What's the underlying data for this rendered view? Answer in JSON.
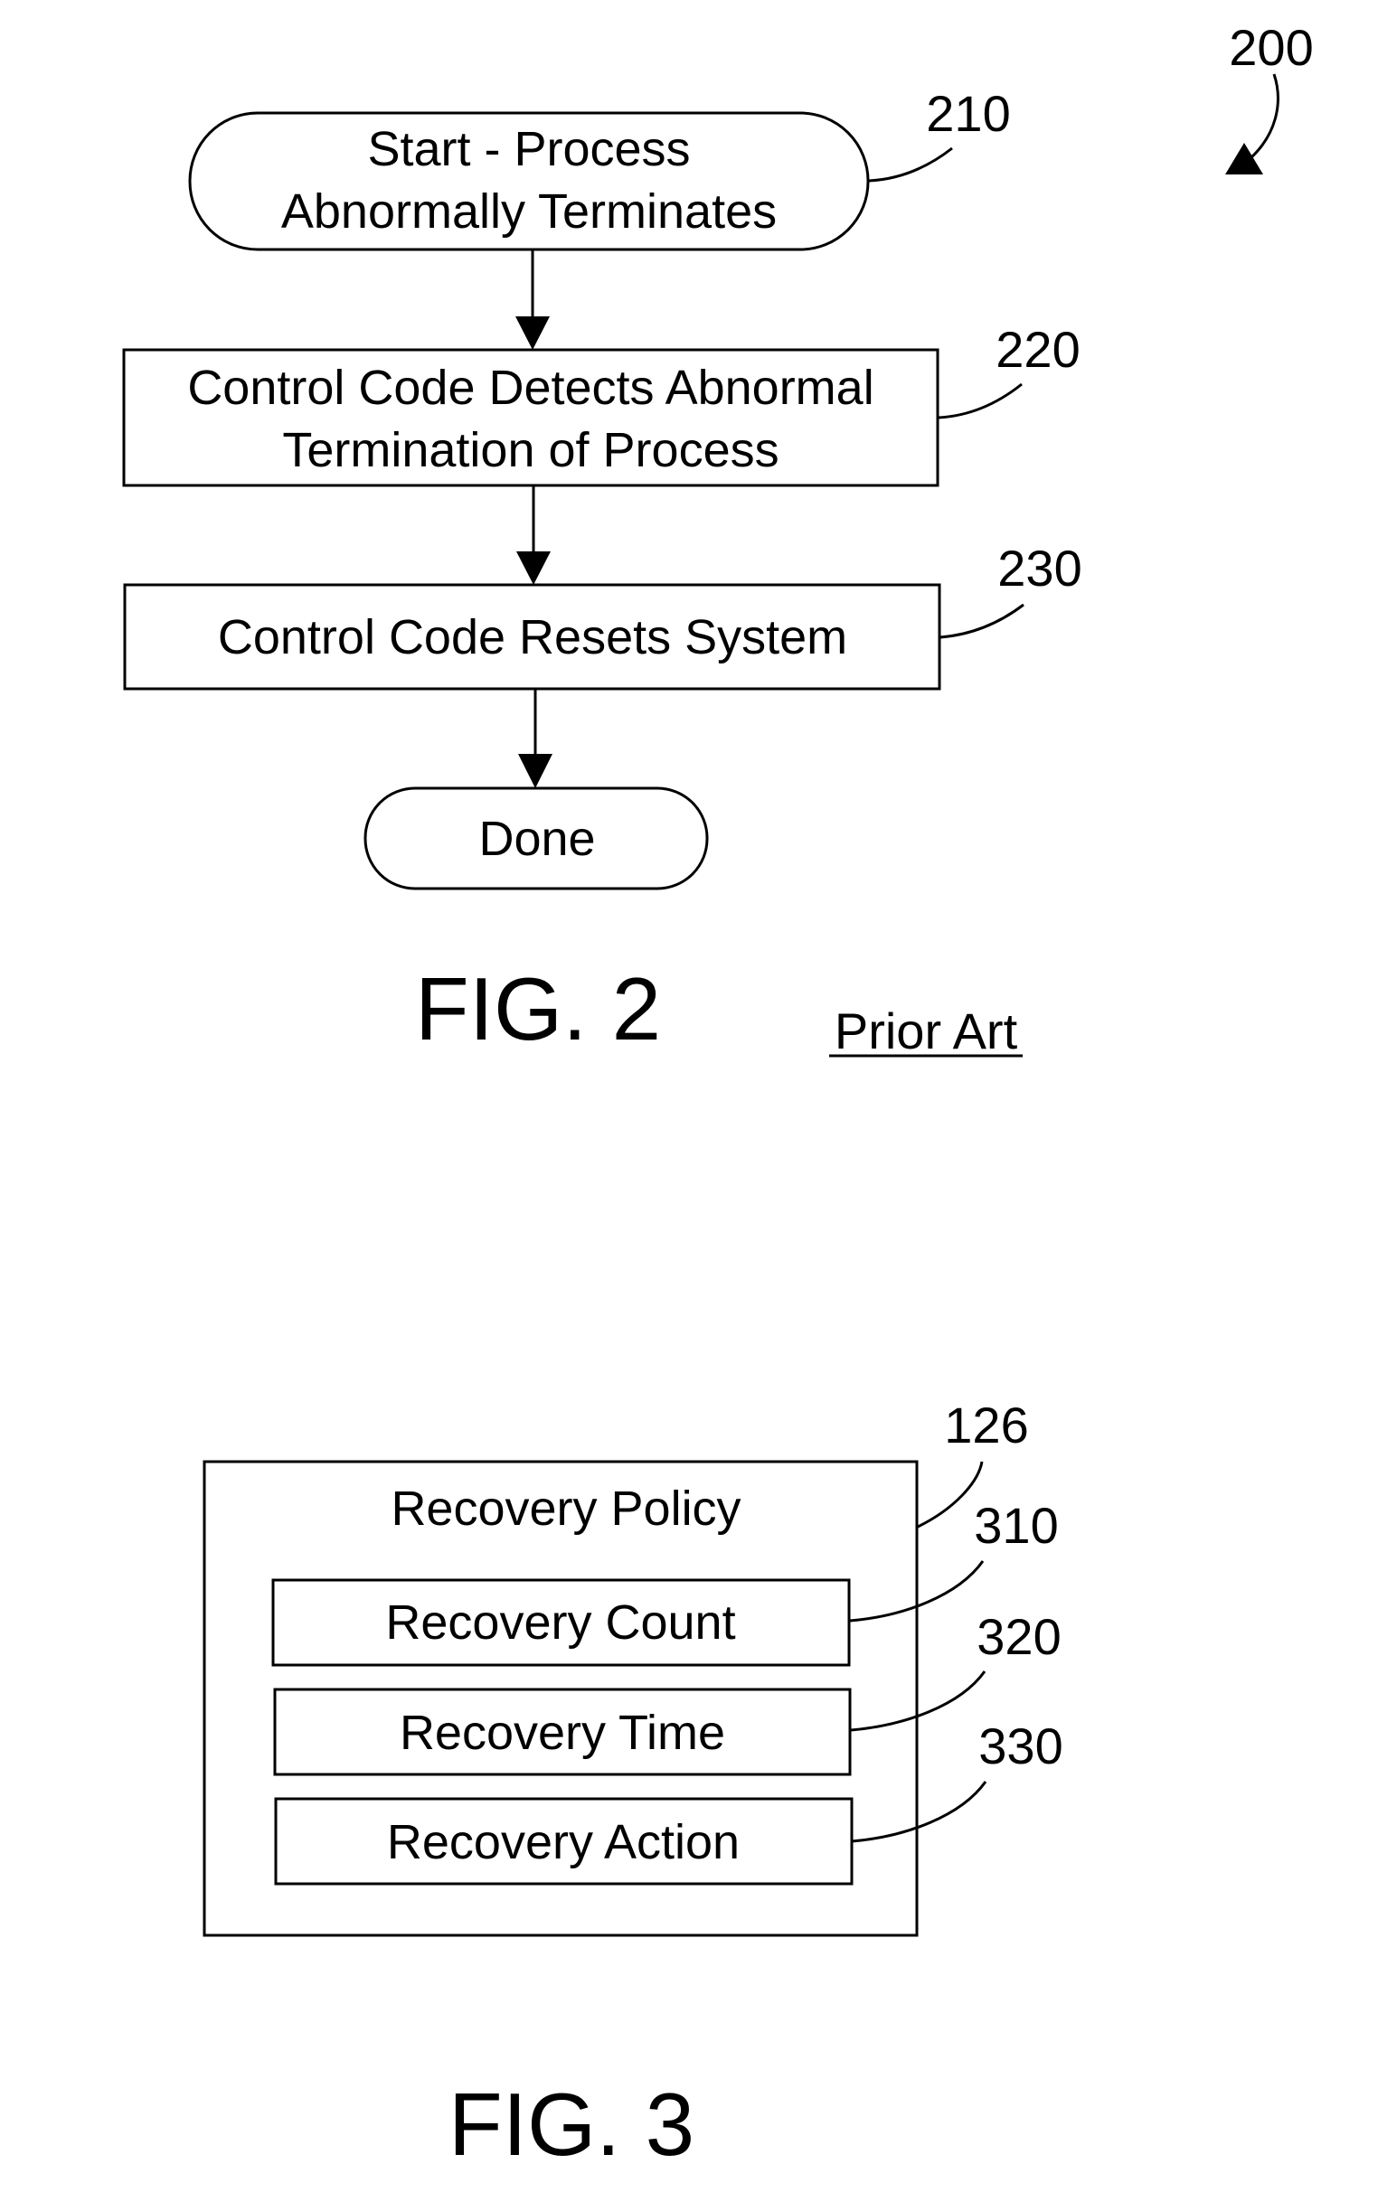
{
  "fig2": {
    "reference": "200",
    "caption": "FIG. 2",
    "note": "Prior Art",
    "steps": [
      {
        "ref": "210",
        "shape": "terminator",
        "lines": [
          "Start - Process",
          "Abnormally Terminates"
        ]
      },
      {
        "ref": "220",
        "shape": "process",
        "lines": [
          "Control Code Detects Abnormal",
          "Termination of Process"
        ]
      },
      {
        "ref": "230",
        "shape": "process",
        "lines": [
          "Control Code Resets System"
        ]
      },
      {
        "ref": "",
        "shape": "terminator",
        "lines": [
          "Done"
        ]
      }
    ]
  },
  "fig3": {
    "caption": "FIG. 3",
    "container": {
      "ref": "126",
      "title": "Recovery Policy"
    },
    "fields": [
      {
        "ref": "310",
        "label": "Recovery Count"
      },
      {
        "ref": "320",
        "label": "Recovery Time"
      },
      {
        "ref": "330",
        "label": "Recovery Action"
      }
    ]
  }
}
